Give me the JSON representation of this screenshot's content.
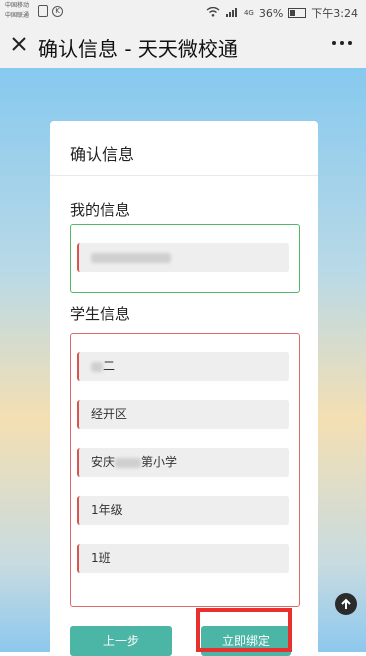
{
  "status_bar": {
    "carrier_1": "中国移动",
    "carrier_2": "中国联通",
    "signal_text": "4G",
    "battery": "36%",
    "time": "下午3:24"
  },
  "title_bar": {
    "close_icon": "close-icon",
    "title": "确认信息 - 天天微校通",
    "more_icon": "more-icon"
  },
  "card": {
    "title": "确认信息",
    "my_info_label": "我的信息",
    "student_info_label": "学生信息",
    "student_fields": [
      {
        "value": "二"
      },
      {
        "value": "经开区"
      },
      {
        "value": "安庆",
        "suffix": "第小学"
      },
      {
        "value": "1年级"
      },
      {
        "value": "1班"
      }
    ]
  },
  "buttons": {
    "prev_label": "上一步",
    "bind_label": "立即绑定"
  },
  "colors": {
    "button": "#4bb5a6",
    "green_border": "#54b866",
    "red_border": "#e06a6a",
    "highlight": "#e8302e"
  },
  "icons": {
    "scroll_top": "arrow-up-circle-icon"
  }
}
